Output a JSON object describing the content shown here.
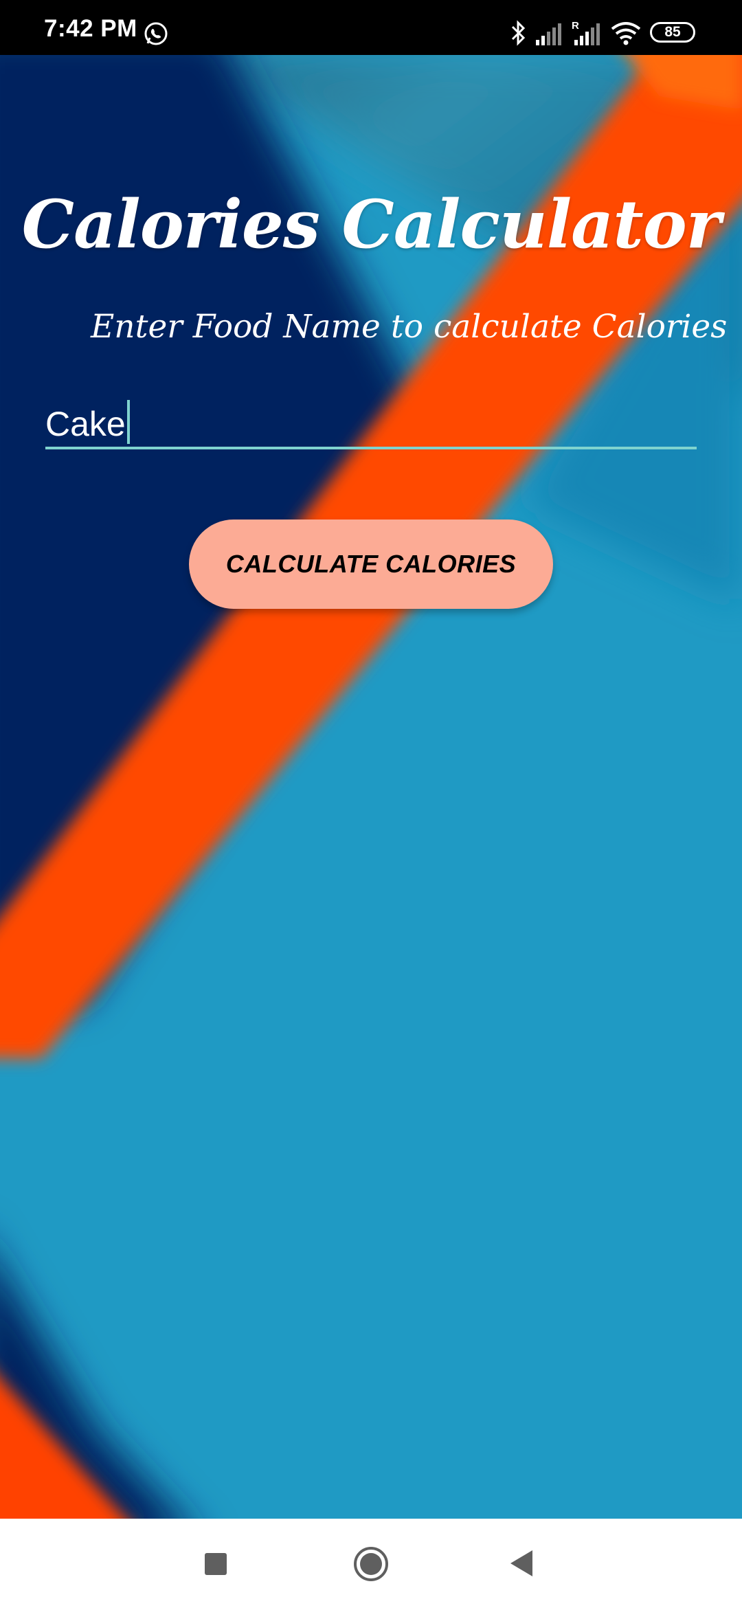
{
  "status_bar": {
    "time": "7:42 PM",
    "battery": "85",
    "icons": [
      "whatsapp-icon",
      "bluetooth-icon",
      "signal-icon",
      "signal-roaming-icon",
      "wifi-icon",
      "battery-icon"
    ],
    "roaming_label": "R"
  },
  "app": {
    "title": "Calories Calculator",
    "subtitle": "Enter Food Name to calculate Calories",
    "food_input_value": "Cake",
    "calculate_button_label": "CALCULATE CALORIES"
  },
  "nav_bar": {
    "icons": [
      "recent-apps-icon",
      "home-icon",
      "back-icon"
    ]
  },
  "colors": {
    "accent_underline": "#7fd3cf",
    "button_bg": "#fcab95",
    "background_blue": "#1f9ac4",
    "background_navy": "#0a1e5c",
    "background_orange": "#ff4a00"
  }
}
